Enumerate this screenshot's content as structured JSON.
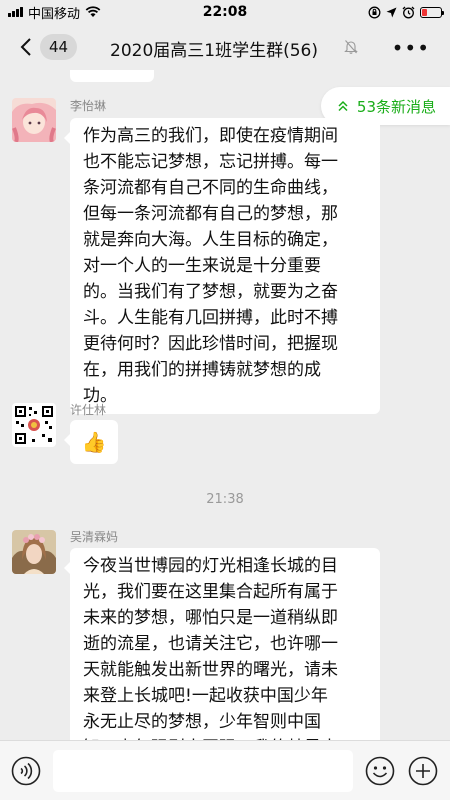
{
  "status_bar": {
    "carrier": "中国移动",
    "time": "22:08"
  },
  "nav": {
    "back_count": "44",
    "title": "2020届高三1班学生群(56)",
    "more": "•••"
  },
  "new_messages": {
    "label": "53条新消息",
    "icon": "double-chevron-up-icon"
  },
  "messages": [
    {
      "sender": "李怡琳",
      "lines": [
        "作为高三的我们，即使在疫情期间",
        "也不能忘记梦想，忘记拼搏。每一",
        "条河流都有自己不同的生命曲线，",
        "但每一条河流都有自己的梦想，那",
        "就是奔向大海。人生目标的确定，",
        "对一个人的一生来说是十分重要",
        "的。当我们有了梦想，就要为之奋",
        "斗。人生能有几回拼搏，此时不搏",
        "更待何时？因此珍惜时间，把握现",
        "在，用我们的拼搏铸就梦想的成",
        "功。"
      ]
    },
    {
      "sender": "许仕林",
      "content": "👍"
    },
    {
      "sender": "吴清霖妈",
      "lines": [
        "今夜当世博园的灯光相逢长城的目",
        "光，我们要在这里集合起所有属于",
        "未来的梦想，哪怕只是一道稍纵即",
        "逝的流星，也请关注它，也许哪一",
        "天就能触发出新世界的曙光，请未",
        "来登上长城吧!一起收获中国少年",
        "永无止尽的梦想，少年智则中国",
        "智，少年强则中国强，我的梦是中"
      ]
    }
  ],
  "time_separator": "21:38",
  "colors": {
    "accent": "#1aad19",
    "background": "#ededed"
  }
}
